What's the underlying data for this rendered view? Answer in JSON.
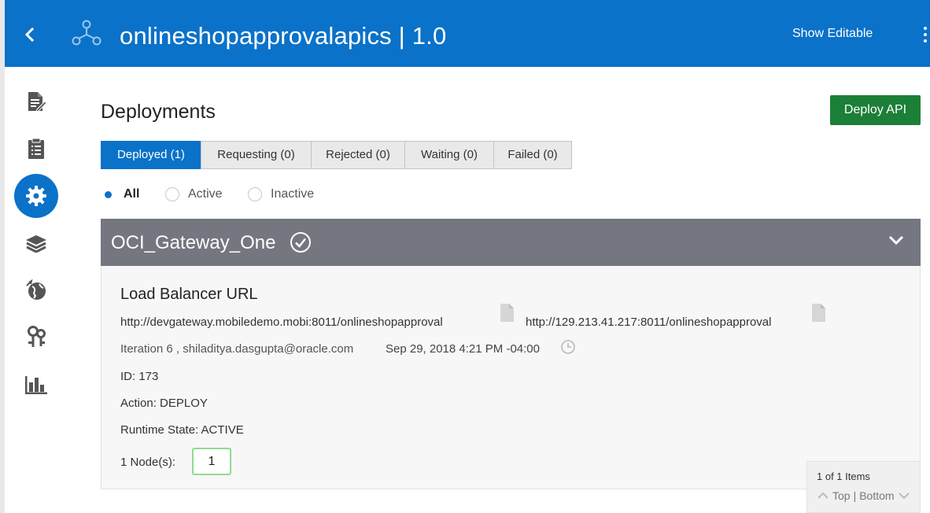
{
  "header": {
    "back_icon": "chevron-left-icon",
    "app_icon": "api-network-icon",
    "title": "onlineshopapprovalapics | 1.0",
    "show_editable": "Show Editable",
    "menu_icon": "kebab-menu-icon",
    "color": "#0a72c9"
  },
  "sidebar": {
    "items": [
      {
        "name": "api-document-icon"
      },
      {
        "name": "clipboard-list-icon"
      },
      {
        "name": "deployments-gear-icon",
        "active": true
      },
      {
        "name": "layers-icon"
      },
      {
        "name": "globe-icon"
      },
      {
        "name": "keys-icon"
      },
      {
        "name": "analytics-bar-chart-icon"
      }
    ]
  },
  "page": {
    "title": "Deployments",
    "deploy_button": "Deploy API"
  },
  "tabs": [
    {
      "label": "Deployed (1)",
      "selected": true
    },
    {
      "label": "Requesting (0)"
    },
    {
      "label": "Rejected (0)"
    },
    {
      "label": "Waiting (0)"
    },
    {
      "label": "Failed (0)"
    }
  ],
  "filters": [
    {
      "label": "All",
      "checked": true
    },
    {
      "label": "Active"
    },
    {
      "label": "Inactive"
    }
  ],
  "gateway": {
    "name": "OCI_Gateway_One",
    "status_icon": "check-circle-icon",
    "expand_icon": "chevron-down-icon",
    "header_color": "#747680",
    "load_balancer_title": "Load Balancer URL",
    "url_1": "http://devgateway.mobiledemo.mobi:8011/onlineshopapproval",
    "url_2": "http://129.213.41.217:8011/onlineshopapproval",
    "meta": "Iteration 6 , shiladitya.dasgupta@oracle.com",
    "date": "Sep 29, 2018 4:21 PM -04:00",
    "id": "ID: 173",
    "action": "Action: DEPLOY",
    "runtime_state": "Runtime State: ACTIVE",
    "nodes_label": "1 Node(s):",
    "nodes_value": "1"
  },
  "pager": {
    "count": "1 of 1 Items",
    "top": "Top",
    "separator": "|",
    "bottom": "Bottom"
  },
  "colors": {
    "deploy_button": "#1c7f37",
    "tab_selected": "#0a72c9",
    "nodes_border": "#8fdc8f"
  }
}
